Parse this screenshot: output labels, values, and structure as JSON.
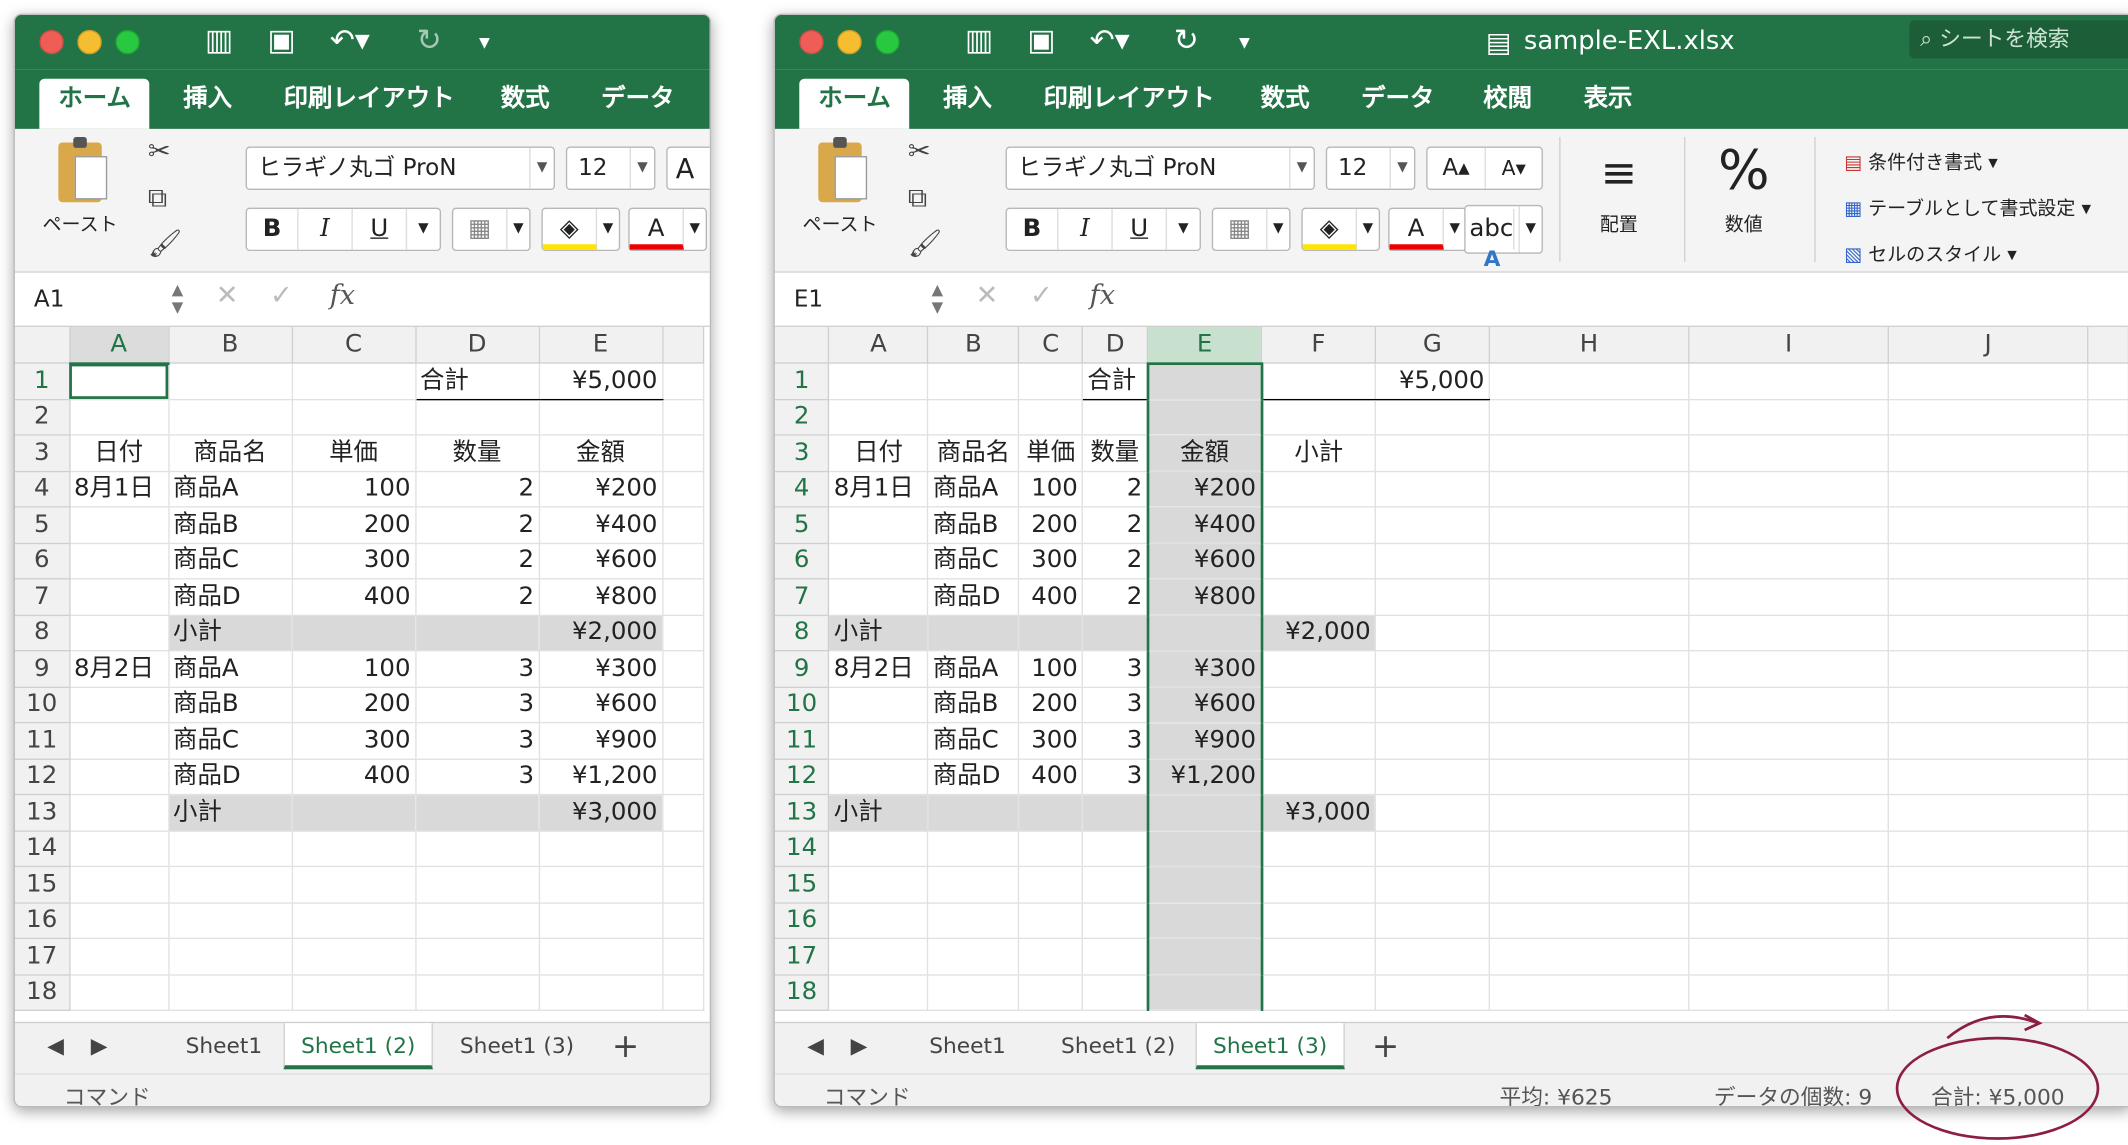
{
  "common": {
    "font": "ヒラギノ丸ゴ ProN",
    "size": "12",
    "paste": "ペースト",
    "status_label": "コマンド",
    "bold": "B",
    "italic": "I",
    "underline": "U",
    "font_color_glyph": "A",
    "grow_glyph": "A▴",
    "shrink_glyph": "A▾",
    "fx": "fx"
  },
  "tabs": {
    "home": "ホーム",
    "insert": "挿入",
    "layout": "印刷レイアウト",
    "formula": "数式",
    "data": "データ",
    "review": "校閲",
    "view": "表示"
  },
  "left": {
    "namebox": "A1",
    "cols": [
      "A",
      "B",
      "C",
      "D",
      "E"
    ],
    "rows": [
      [
        "1",
        "",
        "",
        "",
        "合計",
        "¥5,000"
      ],
      [
        "2",
        "",
        "",
        "",
        "",
        ""
      ],
      [
        "3",
        "日付",
        "商品名",
        "単価",
        "数量",
        "金額"
      ],
      [
        "4",
        "8月1日",
        "商品A",
        "100",
        "2",
        "¥200"
      ],
      [
        "5",
        "",
        "商品B",
        "200",
        "2",
        "¥400"
      ],
      [
        "6",
        "",
        "商品C",
        "300",
        "2",
        "¥600"
      ],
      [
        "7",
        "",
        "商品D",
        "400",
        "2",
        "¥800"
      ],
      [
        "8",
        "",
        "小計",
        "",
        "",
        "¥2,000"
      ],
      [
        "9",
        "8月2日",
        "商品A",
        "100",
        "3",
        "¥300"
      ],
      [
        "10",
        "",
        "商品B",
        "200",
        "3",
        "¥600"
      ],
      [
        "11",
        "",
        "商品C",
        "300",
        "3",
        "¥900"
      ],
      [
        "12",
        "",
        "商品D",
        "400",
        "3",
        "¥1,200"
      ],
      [
        "13",
        "",
        "小計",
        "",
        "",
        "¥3,000"
      ],
      [
        "14",
        "",
        "",
        "",
        "",
        ""
      ],
      [
        "15",
        "",
        "",
        "",
        "",
        ""
      ],
      [
        "16",
        "",
        "",
        "",
        "",
        ""
      ],
      [
        "17",
        "",
        "",
        "",
        "",
        ""
      ],
      [
        "18",
        "",
        "",
        "",
        "",
        ""
      ]
    ],
    "sheets": [
      "Sheet1",
      "Sheet1 (2)",
      "Sheet1 (3)"
    ],
    "active_sheet": "Sheet1 (2)"
  },
  "right": {
    "title": "sample-EXL.xlsx",
    "search": "シートを検索",
    "namebox": "E1",
    "ribbon": {
      "align": "配置",
      "number": "数値",
      "cond": "条件付き書式",
      "table": "テーブルとして書式設定",
      "style": "セルのスタイル",
      "abc": "abc"
    },
    "cols": [
      "A",
      "B",
      "C",
      "D",
      "E",
      "F",
      "G",
      "H",
      "I",
      "J"
    ],
    "rows": [
      [
        "1",
        "",
        "",
        "",
        "合計",
        "",
        "",
        "¥5,000",
        "",
        "",
        ""
      ],
      [
        "2",
        "",
        "",
        "",
        "",
        "",
        "",
        "",
        "",
        "",
        ""
      ],
      [
        "3",
        "日付",
        "商品名",
        "単価",
        "数量",
        "金額",
        "小計",
        "",
        "",
        "",
        ""
      ],
      [
        "4",
        "8月1日",
        "商品A",
        "100",
        "2",
        "¥200",
        "",
        "",
        "",
        "",
        ""
      ],
      [
        "5",
        "",
        "商品B",
        "200",
        "2",
        "¥400",
        "",
        "",
        "",
        "",
        ""
      ],
      [
        "6",
        "",
        "商品C",
        "300",
        "2",
        "¥600",
        "",
        "",
        "",
        "",
        ""
      ],
      [
        "7",
        "",
        "商品D",
        "400",
        "2",
        "¥800",
        "",
        "",
        "",
        "",
        ""
      ],
      [
        "8",
        "小計",
        "",
        "",
        "",
        "",
        "¥2,000",
        "",
        "",
        "",
        ""
      ],
      [
        "9",
        "8月2日",
        "商品A",
        "100",
        "3",
        "¥300",
        "",
        "",
        "",
        "",
        ""
      ],
      [
        "10",
        "",
        "商品B",
        "200",
        "3",
        "¥600",
        "",
        "",
        "",
        "",
        ""
      ],
      [
        "11",
        "",
        "商品C",
        "300",
        "3",
        "¥900",
        "",
        "",
        "",
        "",
        ""
      ],
      [
        "12",
        "",
        "商品D",
        "400",
        "3",
        "¥1,200",
        "",
        "",
        "",
        "",
        ""
      ],
      [
        "13",
        "小計",
        "",
        "",
        "",
        "",
        "¥3,000",
        "",
        "",
        "",
        ""
      ],
      [
        "14",
        "",
        "",
        "",
        "",
        "",
        "",
        "",
        "",
        "",
        ""
      ],
      [
        "15",
        "",
        "",
        "",
        "",
        "",
        "",
        "",
        "",
        "",
        ""
      ],
      [
        "16",
        "",
        "",
        "",
        "",
        "",
        "",
        "",
        "",
        "",
        ""
      ],
      [
        "17",
        "",
        "",
        "",
        "",
        "",
        "",
        "",
        "",
        "",
        ""
      ],
      [
        "18",
        "",
        "",
        "",
        "",
        "",
        "",
        "",
        "",
        "",
        ""
      ]
    ],
    "sheets": [
      "Sheet1",
      "Sheet1 (2)",
      "Sheet1 (3)"
    ],
    "active_sheet": "Sheet1 (3)",
    "status": {
      "avg": "平均: ¥625",
      "count": "データの個数: 9",
      "sum": "合計: ¥5,000"
    }
  }
}
